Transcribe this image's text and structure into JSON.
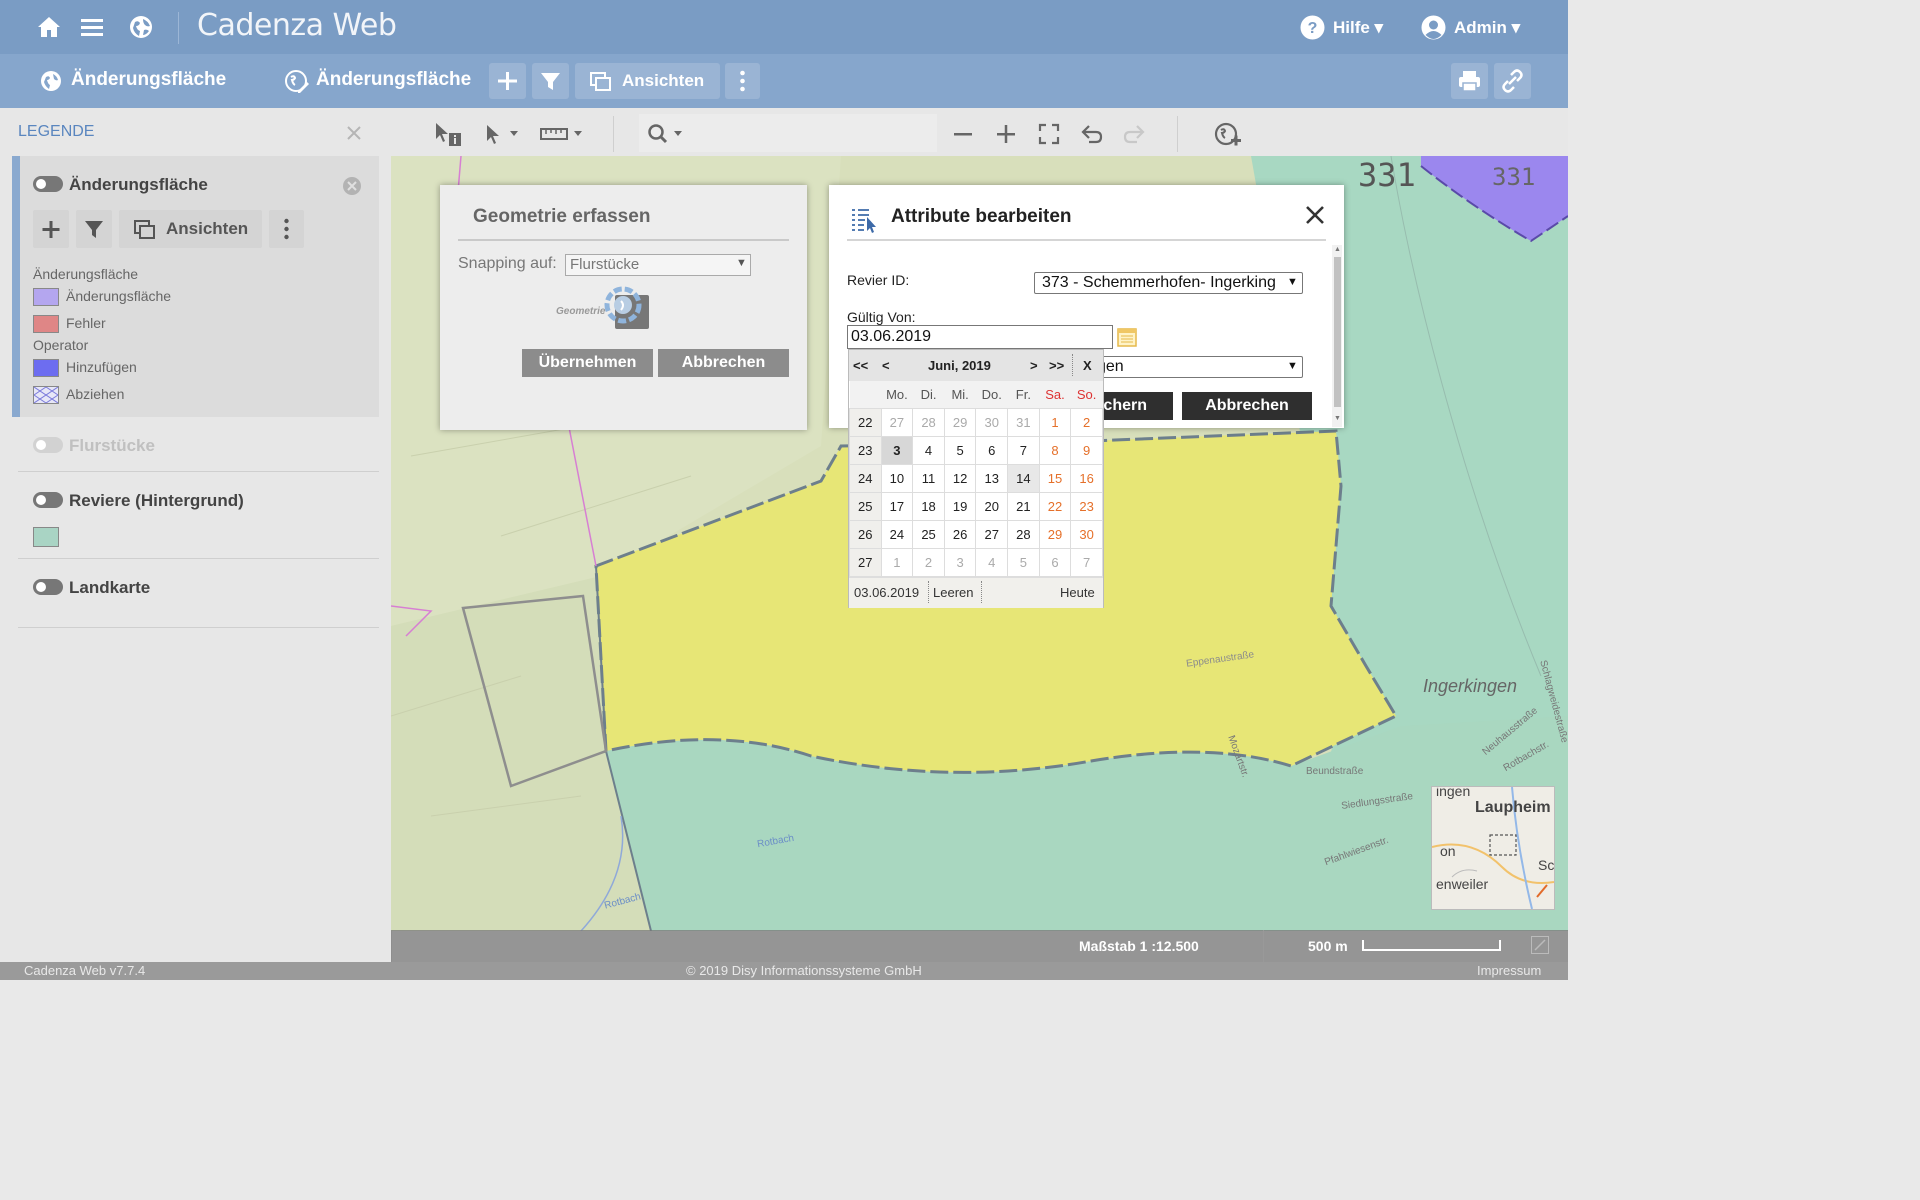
{
  "app": {
    "brand": "Cadenza Web",
    "help_label": "Hilfe ▾",
    "admin_label": "Admin ▾"
  },
  "subbar": {
    "layer_left": "Änderungsfläche",
    "layer_right": "Änderungsfläche",
    "views_label": "Ansichten"
  },
  "legend": {
    "title": "LEGENDE",
    "layer1": {
      "name": "Änderungsfläche",
      "views_label": "Ansichten",
      "group1": "Änderungsfläche",
      "item1": "Änderungsfläche",
      "item2": "Fehler",
      "group2": "Operator",
      "item3": "Hinzufügen",
      "item4": "Abziehen"
    },
    "layer2": "Flurstücke",
    "layer3": "Reviere (Hintergrund)",
    "layer4": "Landkarte",
    "colors": {
      "aenderung": "#b4a6ef",
      "fehler": "#df8686",
      "hinzu": "#6d6df0",
      "reviere": "#a9d4c4"
    }
  },
  "geometry_dialog": {
    "title": "Geometrie erfassen",
    "snapping_label": "Snapping auf:",
    "snapping_value": "Flurstücke",
    "loading_text": "Geometrie",
    "ok_label": "Übernehmen",
    "cancel_label": "Abbrechen"
  },
  "attr_dialog": {
    "title": "Attribute bearbeiten",
    "revier_label": "Revier ID:",
    "revier_value": "373 - Schemmerhofen- Ingerking",
    "valid_from_label": "Gültig Von:",
    "valid_from_value": "03.06.2019",
    "hidden_select_value": "gen",
    "save_label": "chern",
    "cancel_label": "Abbrechen"
  },
  "calendar": {
    "nav_prev_year": "<<",
    "nav_prev": "<",
    "month_label": "Juni, 2019",
    "nav_next": ">",
    "nav_next_year": ">>",
    "close": "X",
    "weekdays": [
      "Mo.",
      "Di.",
      "Mi.",
      "Do.",
      "Fr.",
      "Sa.",
      "So."
    ],
    "weeks": [
      {
        "wk": "22",
        "days": [
          "27",
          "28",
          "29",
          "30",
          "31",
          "1",
          "2"
        ]
      },
      {
        "wk": "23",
        "days": [
          "3",
          "4",
          "5",
          "6",
          "7",
          "8",
          "9"
        ]
      },
      {
        "wk": "24",
        "days": [
          "10",
          "11",
          "12",
          "13",
          "14",
          "15",
          "16"
        ]
      },
      {
        "wk": "25",
        "days": [
          "17",
          "18",
          "19",
          "20",
          "21",
          "22",
          "23"
        ]
      },
      {
        "wk": "26",
        "days": [
          "24",
          "25",
          "26",
          "27",
          "28",
          "29",
          "30"
        ]
      },
      {
        "wk": "27",
        "days": [
          "1",
          "2",
          "3",
          "4",
          "5",
          "6",
          "7"
        ]
      }
    ],
    "footer_date": "03.06.2019",
    "clear_label": "Leeren",
    "today_label": "Heute"
  },
  "map": {
    "label_331a": "331",
    "label_331b": "331",
    "town": "Ingerkingen",
    "street1": "Eppenaustraße",
    "street2": "Beundstraße",
    "street3": "Siedlungsstraße",
    "street4": "Pfahlwiesenstr.",
    "street5": "Rotbach",
    "street6": "Rotbach",
    "street7": "Mozartstr.",
    "street8": "Neuhausstraße",
    "street9": "Rotbachstr.",
    "street10": "Schlagweidestraße",
    "overview": {
      "town1": "Laupheim",
      "town2": "on",
      "town3": "Sc",
      "town4": "enweiler",
      "town5": "ingen"
    }
  },
  "status": {
    "scale_label": "Maßstab 1 :12.500",
    "scalebar_label": "500 m"
  },
  "footer": {
    "version": "Cadenza Web v7.7.4",
    "copyright": "© 2019 Disy Informationssysteme GmbH",
    "impressum": "Impressum"
  }
}
